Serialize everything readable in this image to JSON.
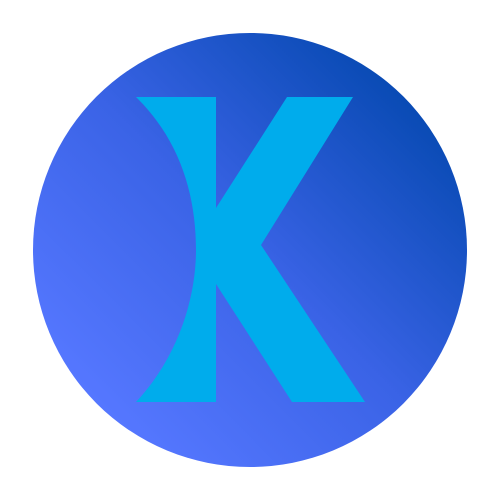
{
  "logo": {
    "letter": "K",
    "icon": "k-logo-icon",
    "colors": {
      "circle_gradient_light": "#5577ff",
      "circle_gradient_mid": "#3a63e6",
      "circle_gradient_dark": "#0a4bb5",
      "letter": "#00acec",
      "background": "#ffffff"
    }
  }
}
